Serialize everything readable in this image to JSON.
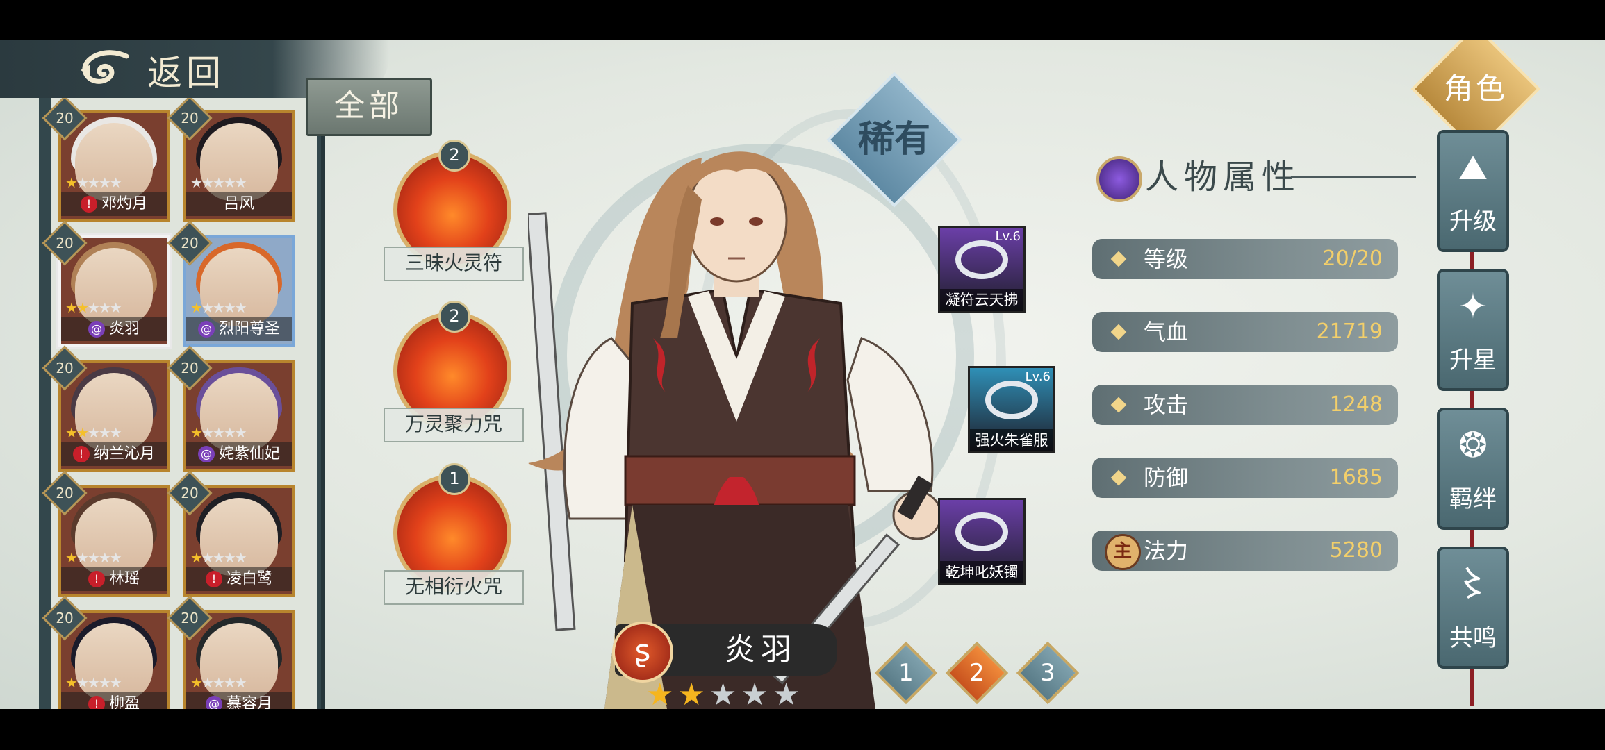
{
  "header": {
    "back_label": "返回",
    "filter_label": "全部"
  },
  "roster": [
    {
      "level": "20",
      "name": "邓灼月",
      "stars": 1,
      "badge": "red",
      "frame": "gold",
      "hair": "#e9e7e4"
    },
    {
      "level": "20",
      "name": "吕风",
      "stars": 0,
      "badge": "none",
      "frame": "gold",
      "hair": "#1e1a1f"
    },
    {
      "level": "20",
      "name": "炎羽",
      "stars": 2,
      "badge": "purple",
      "frame": "selected",
      "hair": "#b08156"
    },
    {
      "level": "20",
      "name": "烈阳尊圣",
      "stars": 1,
      "badge": "purple",
      "frame": "blue",
      "hair": "#d8682a"
    },
    {
      "level": "20",
      "name": "纳兰沁月",
      "stars": 2,
      "badge": "red",
      "frame": "gold",
      "hair": "#4a3a44"
    },
    {
      "level": "20",
      "name": "姹紫仙妃",
      "stars": 1,
      "badge": "purple",
      "frame": "gold",
      "hair": "#6a4f9a"
    },
    {
      "level": "20",
      "name": "林瑶",
      "stars": 1,
      "badge": "red",
      "frame": "gold",
      "hair": "#5a3a2c"
    },
    {
      "level": "20",
      "name": "凌白鹭",
      "stars": 1,
      "badge": "red",
      "frame": "gold",
      "hair": "#1f1f24"
    },
    {
      "level": "20",
      "name": "柳盈",
      "stars": 1,
      "badge": "red",
      "frame": "gold",
      "hair": "#1b1b2a"
    },
    {
      "level": "20",
      "name": "慕容月",
      "stars": 1,
      "badge": "purple",
      "frame": "gold",
      "hair": "#23282a"
    }
  ],
  "skills": [
    {
      "level": "2",
      "name": "三昧火灵符"
    },
    {
      "level": "2",
      "name": "万灵聚力咒"
    },
    {
      "level": "1",
      "name": "无相衍火咒"
    }
  ],
  "rarity": "稀有",
  "equipment": [
    {
      "lv": "Lv.6",
      "name": "凝符云天拂",
      "color": "#6b3fa8"
    },
    {
      "lv": "Lv.6",
      "name": "强火朱雀服",
      "color": "#2f8fb6"
    },
    {
      "name": "乾坤叱妖镯",
      "color": "#6b3fa8"
    }
  ],
  "character": {
    "name": "炎羽",
    "element_icon": "flame-swirl-icon",
    "stars_filled": 2,
    "stars_total": 5
  },
  "page_tabs": [
    {
      "label": "1",
      "active": false
    },
    {
      "label": "2",
      "active": true
    },
    {
      "label": "3",
      "active": false
    }
  ],
  "attributes": {
    "title": "人物属性",
    "rows": [
      {
        "label": "等级",
        "value": "20/20"
      },
      {
        "label": "气血",
        "value": "21719"
      },
      {
        "label": "攻击",
        "value": "1248"
      },
      {
        "label": "防御",
        "value": "1685"
      },
      {
        "label": "法力",
        "value": "5280",
        "icon_text": "主"
      }
    ]
  },
  "menu": {
    "role_tab": "角色",
    "items": [
      {
        "label": "升级",
        "icon": "mountain-icon"
      },
      {
        "label": "升星",
        "icon": "star-swirl-icon"
      },
      {
        "label": "羁绊",
        "icon": "bond-swirl-icon"
      },
      {
        "label": "共鸣",
        "icon": "resonance-icon"
      }
    ]
  },
  "colors": {
    "accent_gold": "#c9a86a",
    "value_gold": "#f3cf6a",
    "panel_dark": "#33474c"
  }
}
